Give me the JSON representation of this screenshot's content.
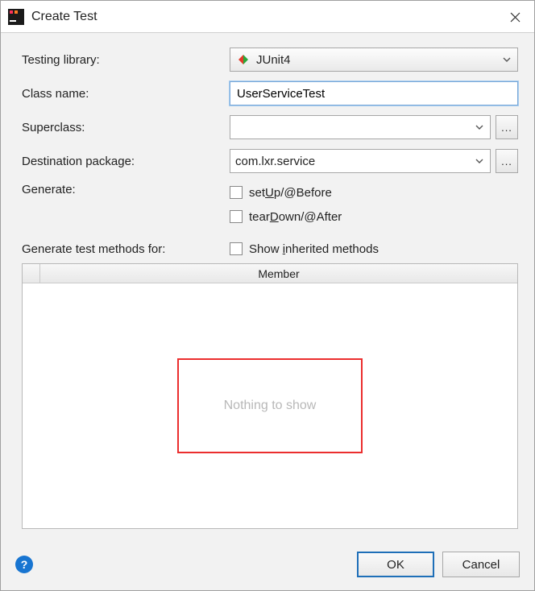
{
  "window": {
    "title": "Create Test"
  },
  "labels": {
    "testing_library": "Testing library:",
    "class_name": "Class name:",
    "superclass": "Superclass:",
    "destination_package": "Destination package:",
    "generate": "Generate:",
    "generate_methods_for": "Generate test methods for:"
  },
  "testing_library": {
    "selected": "JUnit4"
  },
  "class_name": {
    "value": "UserServiceTest"
  },
  "superclass": {
    "value": ""
  },
  "destination_package": {
    "value": "com.lxr.service"
  },
  "generate": {
    "setup_prefix": "set",
    "setup_u": "U",
    "setup_suffix": "p/@Before",
    "teardown_prefix": "tear",
    "teardown_u": "D",
    "teardown_suffix": "own/@After"
  },
  "show_inherited": {
    "prefix": "Show ",
    "u": "i",
    "suffix": "nherited methods"
  },
  "table": {
    "header_member": "Member",
    "empty_text": "Nothing to show"
  },
  "buttons": {
    "browse": "...",
    "ok": "OK",
    "cancel": "Cancel",
    "help": "?"
  }
}
